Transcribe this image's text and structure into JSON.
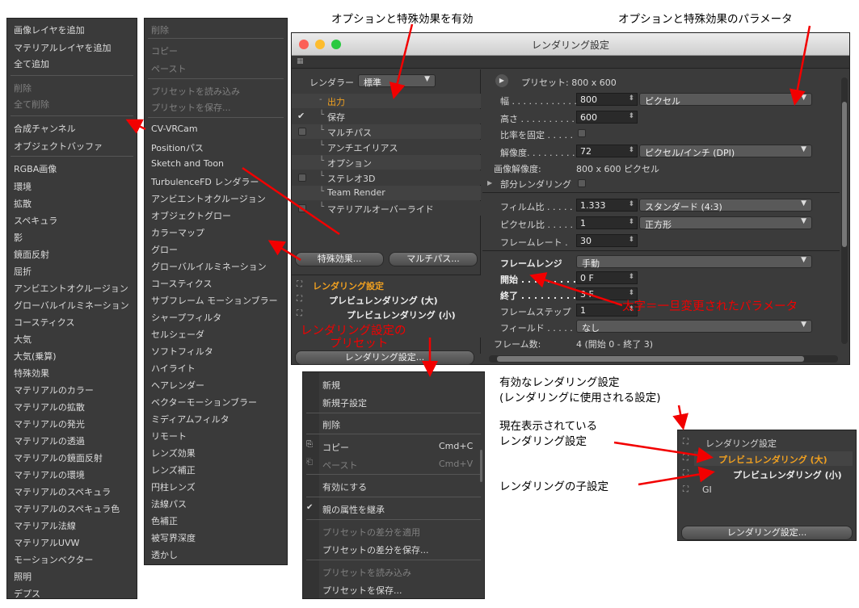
{
  "captions": {
    "enable": "オプションと特殊効果を有効",
    "params": "オプションと特殊効果のパラメータ",
    "active": "有効なレンダリング設定",
    "active_sub": "(レンダリングに使用される設定)",
    "current1": "現在表示されている",
    "current2": "レンダリング設定",
    "child": "レンダリングの子設定"
  },
  "red_notes": {
    "bold": "太字＝一旦変更されたパラメータ",
    "preset1": "レンダリング設定の",
    "preset2": "プリセット"
  },
  "menu_left": {
    "items": [
      {
        "label": "画像レイヤを追加",
        "dis": false
      },
      {
        "label": "マテリアルレイヤを追加",
        "dis": false
      },
      {
        "label": "全て追加",
        "dis": false
      },
      {
        "label": "削除",
        "dis": true
      },
      {
        "label": "全て削除",
        "dis": true
      },
      {
        "label": "合成チャンネル",
        "dis": false
      },
      {
        "label": "オブジェクトバッファ",
        "dis": false
      },
      {
        "label": "RGBA画像",
        "dis": false
      },
      {
        "label": "環境",
        "dis": false
      },
      {
        "label": "拡散",
        "dis": false
      },
      {
        "label": "スペキュラ",
        "dis": false
      },
      {
        "label": "影",
        "dis": false
      },
      {
        "label": "鏡面反射",
        "dis": false
      },
      {
        "label": "屈折",
        "dis": false
      },
      {
        "label": "アンビエントオクルージョン",
        "dis": false
      },
      {
        "label": "グローバルイルミネーション",
        "dis": false
      },
      {
        "label": "コースティクス",
        "dis": false
      },
      {
        "label": "大気",
        "dis": false
      },
      {
        "label": "大気(乗算)",
        "dis": false
      },
      {
        "label": "特殊効果",
        "dis": false
      },
      {
        "label": "マテリアルのカラー",
        "dis": false
      },
      {
        "label": "マテリアルの拡散",
        "dis": false
      },
      {
        "label": "マテリアルの発光",
        "dis": false
      },
      {
        "label": "マテリアルの透過",
        "dis": false
      },
      {
        "label": "マテリアルの鏡面反射",
        "dis": false
      },
      {
        "label": "マテリアルの環境",
        "dis": false
      },
      {
        "label": "マテリアルのスペキュラ",
        "dis": false
      },
      {
        "label": "マテリアルのスペキュラ色",
        "dis": false
      },
      {
        "label": "マテリアル法線",
        "dis": false
      },
      {
        "label": "マテリアルUVW",
        "dis": false
      },
      {
        "label": "モーションベクター",
        "dis": false
      },
      {
        "label": "照明",
        "dis": false
      },
      {
        "label": "デプス",
        "dis": false
      }
    ]
  },
  "menu_mid": {
    "items": [
      {
        "label": "削除",
        "dis": true
      },
      {
        "label": "コピー",
        "dis": true
      },
      {
        "label": "ペースト",
        "dis": true
      },
      {
        "label": "プリセットを読み込み",
        "dis": true
      },
      {
        "label": "プリセットを保存...",
        "dis": true
      },
      {
        "label": "CV-VRCam",
        "dis": false
      },
      {
        "label": "Positionパス",
        "dis": false
      },
      {
        "label": "Sketch and Toon",
        "dis": false
      },
      {
        "label": "TurbulenceFD レンダラー",
        "dis": false
      },
      {
        "label": "アンビエントオクルージョン",
        "dis": false
      },
      {
        "label": "オブジェクトグロー",
        "dis": false
      },
      {
        "label": "カラーマップ",
        "dis": false
      },
      {
        "label": "グロー",
        "dis": false
      },
      {
        "label": "グローバルイルミネーション",
        "dis": false
      },
      {
        "label": "コースティクス",
        "dis": false
      },
      {
        "label": "サブフレーム モーションブラー",
        "dis": false
      },
      {
        "label": "シャープフィルタ",
        "dis": false
      },
      {
        "label": "セルシェーダ",
        "dis": false
      },
      {
        "label": "ソフトフィルタ",
        "dis": false
      },
      {
        "label": "ハイライト",
        "dis": false
      },
      {
        "label": "ヘアレンダー",
        "dis": false
      },
      {
        "label": "ベクターモーションブラー",
        "dis": false
      },
      {
        "label": "ミディアムフィルタ",
        "dis": false
      },
      {
        "label": "リモート",
        "dis": false
      },
      {
        "label": "レンズ効果",
        "dis": false
      },
      {
        "label": "レンズ補正",
        "dis": false
      },
      {
        "label": "円柱レンズ",
        "dis": false
      },
      {
        "label": "法線パス",
        "dis": false
      },
      {
        "label": "色補正",
        "dis": false
      },
      {
        "label": "被写界深度",
        "dis": false
      },
      {
        "label": "透かし",
        "dis": false
      }
    ]
  },
  "window": {
    "title": "レンダリング設定",
    "renderer_label": "レンダラー",
    "renderer_value": "標準",
    "effects": [
      "出力",
      "保存",
      "マルチパス",
      "アンチエイリアス",
      "オプション",
      "ステレオ3D",
      "Team Render",
      "マテリアルオーバーライド"
    ],
    "effects_button": "特殊効果...",
    "multipass_button": "マルチパス...",
    "tree": [
      "レンダリング設定",
      "プレビュレンダリング (大)",
      "プレビュレンダリング (小)"
    ],
    "settings_button": "レンダリング設定...",
    "preset_label": "プリセット: 800 x 600",
    "width_label": "幅 . . . . . . . . . . . .",
    "width_value": "800",
    "width_unit": "ピクセル",
    "height_label": "高さ . . . . . . . . . . .",
    "height_value": "600",
    "ratio_label": "比率を固定 . . . . .",
    "res_label": "解像度. . . . . . . . .",
    "res_value": "72",
    "res_unit": "ピクセル/インチ (DPI)",
    "imgres_label": "画像解像度:",
    "imgres_value": "800 x 600 ピクセル",
    "partial_label": "部分レンダリング",
    "film_label": "フィルム比 . . . . . .",
    "film_value": "1.333",
    "film_preset": "スタンダード (4:3)",
    "pixel_label": "ピクセル比 . . . . .",
    "pixel_value": "1",
    "pixel_preset": "正方形",
    "fps_label": "フレームレート .",
    "fps_value": "30",
    "range_label": "フレームレンジ",
    "range_value": "手動",
    "start_label": "開始 . . . . . . . . . . .",
    "start_value": "0 F",
    "end_label": "終了 . . . . . . . . . . .",
    "end_value": "3 F",
    "step_label": "フレームステップ",
    "step_value": "1",
    "field_label": "フィールド . . . . . .",
    "field_value": "なし",
    "frames_label": "フレーム数:",
    "frames_value": "4 (開始 0 - 終了 3)"
  },
  "menu_bottom": {
    "new": "新規",
    "new_child": "新規子設定",
    "delete": "削除",
    "copy": "コピー",
    "copy_sc": "Cmd+C",
    "paste": "ペースト",
    "paste_sc": "Cmd+V",
    "enable": "有効にする",
    "inherit": "親の属性を継承",
    "apply_diff": "プリセットの差分を適用",
    "save_diff": "プリセットの差分を保存...",
    "load_preset": "プリセットを読み込み",
    "save_preset": "プリセットを保存..."
  },
  "mini_panel": {
    "items": [
      "レンダリング設定",
      "プレビュレンダリング (大)",
      "プレビュレンダリング (小)",
      "GI"
    ],
    "button": "レンダリング設定..."
  },
  "colors": {
    "accent_orange": "#f0a020",
    "red": "#f20000"
  }
}
